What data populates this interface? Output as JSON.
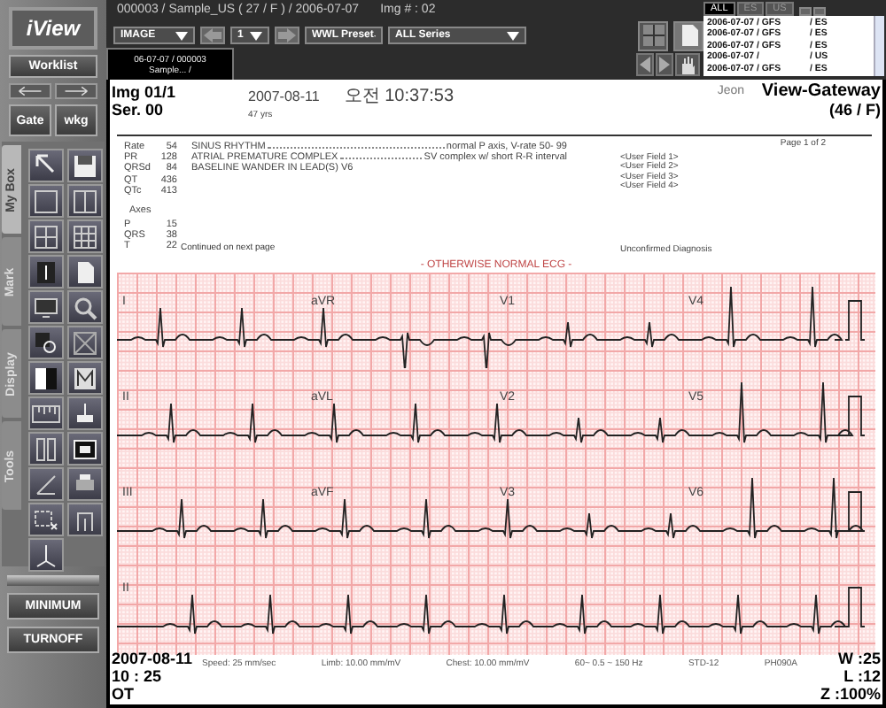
{
  "app": {
    "logo": "iView"
  },
  "header": {
    "title": "000003 / Sample_US ( 27 / F ) / 2006-07-07",
    "image_number": "Img # : 02",
    "mode": "IMAGE",
    "frame": "1",
    "wwl": "WWL Preset",
    "series": "ALL Series"
  },
  "image_tabs": [
    {
      "line1": "06-07-07 / 000003",
      "line2": "Sample... /",
      "selected": true
    }
  ],
  "study_tabs": [
    {
      "label": "ALL",
      "selected": true
    },
    {
      "label": "ES",
      "selected": false
    },
    {
      "label": "US",
      "selected": false
    }
  ],
  "study_list": [
    {
      "date": "2006-07-07 / GFS",
      "modality": "/ ES"
    },
    {
      "date": "2006-07-07 / GFS",
      "modality": "/ ES"
    },
    {
      "date": "2006-07-07 / GFS",
      "modality": "/ ES"
    },
    {
      "date": "2006-07-07 /",
      "modality": "/ US"
    },
    {
      "date": "2006-07-07 / GFS",
      "modality": "/ ES"
    }
  ],
  "sidebar": {
    "worklist": "Worklist",
    "gate": "Gate",
    "wkg": "wkg",
    "tabs": [
      {
        "label": "My Box",
        "selected": true
      },
      {
        "label": "Mark",
        "selected": false
      },
      {
        "label": "Display",
        "selected": false
      },
      {
        "label": "Tools",
        "selected": false
      }
    ],
    "buttons": [
      "MINIMUM",
      "TURNOFF"
    ]
  },
  "overlay": {
    "top_left": [
      "Img 01/1",
      "Ser. 00"
    ],
    "top_right": [
      "View-Gateway",
      "(46 / F)"
    ],
    "bottom_left": [
      "2007-08-11",
      "10 : 25",
      "OT"
    ],
    "bottom_right": [
      "W :25",
      "L :12",
      "Z :100%"
    ]
  },
  "report": {
    "name": "Jeon",
    "date": "2007-08-11",
    "time": "오전 10:37:53",
    "age": "47 yrs",
    "page": "Page 1 of 2",
    "measurements": [
      {
        "label": "Rate",
        "value": "54"
      },
      {
        "label": "PR",
        "value": "128"
      },
      {
        "label": "QRSd",
        "value": "84"
      },
      {
        "label": "QT",
        "value": "436"
      },
      {
        "label": "QTc",
        "value": "413"
      }
    ],
    "axes_title": "Axes",
    "axes": [
      {
        "label": "P",
        "value": "15"
      },
      {
        "label": "QRS",
        "value": "38"
      },
      {
        "label": "T",
        "value": "22"
      }
    ],
    "interpretations": [
      {
        "statement": "SINUS RHYTHM",
        "detail": "normal P axis, V-rate 50- 99"
      },
      {
        "statement": "ATRIAL PREMATURE COMPLEX",
        "detail": "SV complex w/ short R-R interval"
      },
      {
        "statement": "BASELINE WANDER IN LEAD(S) V6"
      }
    ],
    "user_fields": [
      "<User Field 1>",
      "<User Field 2>",
      "<User Field 3>",
      "<User Field 4>"
    ],
    "continued": "Continued on next page",
    "status": "Unconfirmed Diagnosis",
    "banner": "- OTHERWISE NORMAL ECG -",
    "leads": [
      [
        "I",
        "aVR",
        "V1",
        "V4"
      ],
      [
        "II",
        "aVL",
        "V2",
        "V5"
      ],
      [
        "III",
        "aVF",
        "V3",
        "V6"
      ],
      [
        "II"
      ]
    ],
    "footer": [
      "Speed: 25 mm/sec",
      "Limb: 10.00 mm/mV",
      "Chest: 10.00 mm/mV",
      "60~ 0.5 ~ 150 Hz",
      "STD-12",
      "PH090A"
    ]
  }
}
